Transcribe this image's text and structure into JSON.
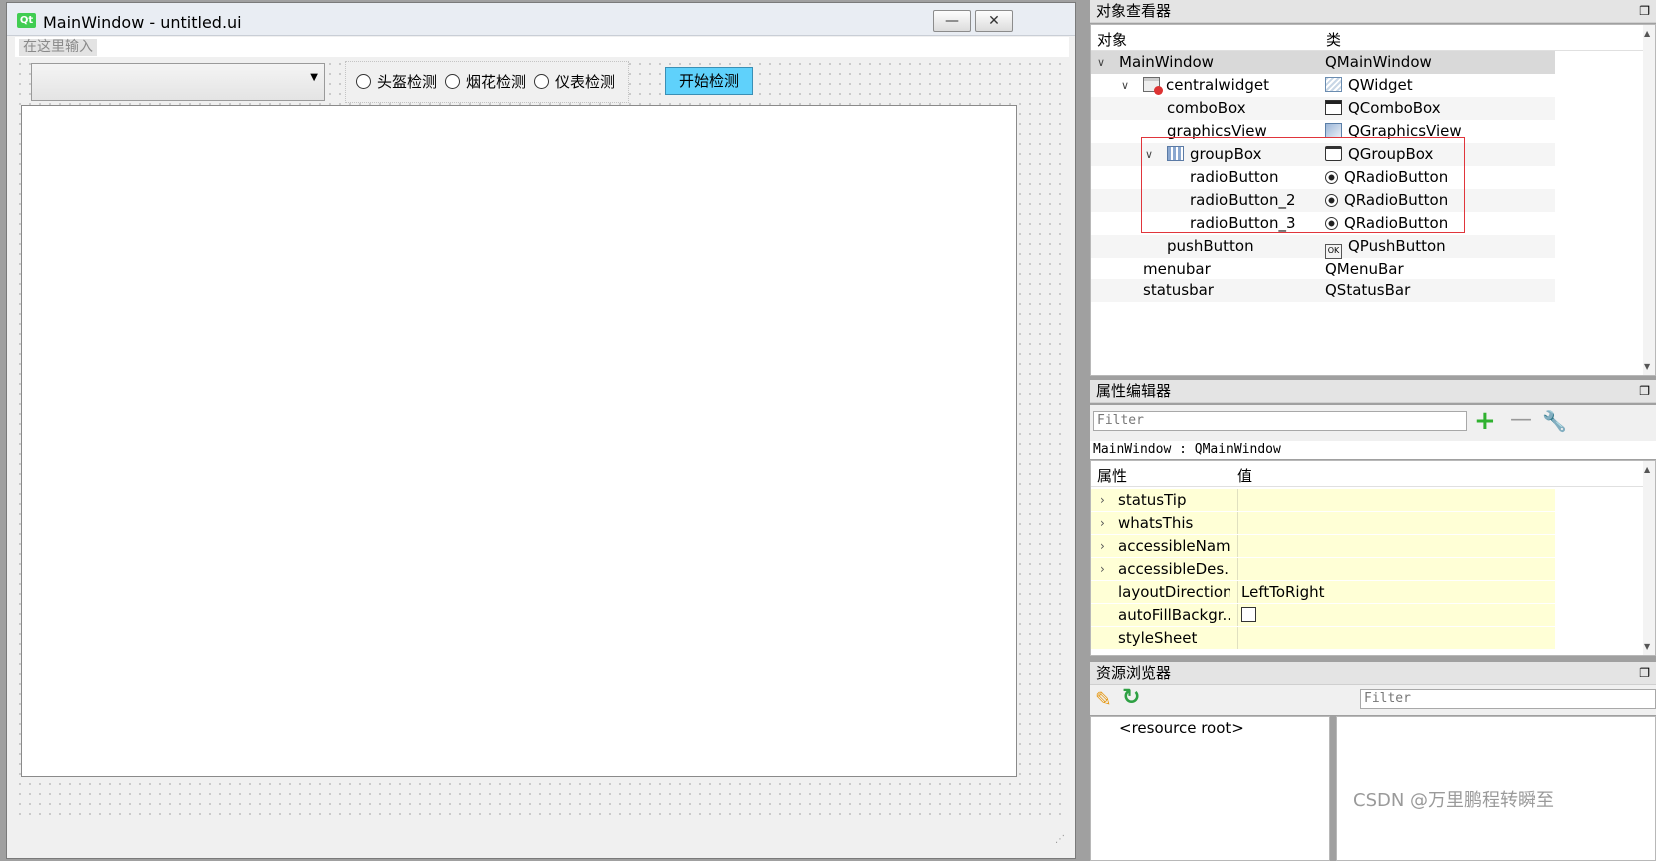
{
  "form_window": {
    "logo_text": "Qt",
    "title": "MainWindow - untitled.ui",
    "minimize_glyph": "—",
    "close_glyph": "✕",
    "menu_placeholder": "在这里输入",
    "combo_value": "",
    "radio_buttons": [
      {
        "label": "头盔检测"
      },
      {
        "label": "烟花检测"
      },
      {
        "label": "仪表检测"
      }
    ],
    "start_button": "开始检测"
  },
  "object_inspector": {
    "title": "对象查看器",
    "col_object": "对象",
    "col_class": "类",
    "rows": [
      {
        "name": "MainWindow",
        "class": "QMainWindow",
        "icon": "",
        "expanded": true
      },
      {
        "name": "centralwidget",
        "class": "QWidget",
        "icon": "widget-icon",
        "expanded": true
      },
      {
        "name": "comboBox",
        "class": "QComboBox",
        "icon": "combobox-icon"
      },
      {
        "name": "graphicsView",
        "class": "QGraphicsView",
        "icon": "graphicsview-icon"
      },
      {
        "name": "groupBox",
        "class": "QGroupBox",
        "icon": "groupbox-icon",
        "expanded": true
      },
      {
        "name": "radioButton",
        "class": "QRadioButton",
        "icon": "radiobutton-icon"
      },
      {
        "name": "radioButton_2",
        "class": "QRadioButton",
        "icon": "radiobutton-icon"
      },
      {
        "name": "radioButton_3",
        "class": "QRadioButton",
        "icon": "radiobutton-icon"
      },
      {
        "name": "pushButton",
        "class": "QPushButton",
        "icon": "pushbutton-icon"
      },
      {
        "name": "menubar",
        "class": "QMenuBar",
        "icon": ""
      },
      {
        "name": "statusbar",
        "class": "QStatusBar",
        "icon": ""
      }
    ],
    "highlight_color": "#e0353b"
  },
  "property_editor": {
    "title": "属性编辑器",
    "filter_placeholder": "Filter",
    "object_label": "MainWindow : QMainWindow",
    "col_property": "属性",
    "col_value": "值",
    "rows": [
      {
        "name": "statusTip",
        "value": "",
        "expandable": true
      },
      {
        "name": "whatsThis",
        "value": "",
        "expandable": true
      },
      {
        "name": "accessibleName",
        "value": "",
        "expandable": true
      },
      {
        "name": "accessibleDes...",
        "value": "",
        "expandable": true
      },
      {
        "name": "layoutDirection",
        "value": "LeftToRight",
        "expandable": false
      },
      {
        "name": "autoFillBackgr...",
        "value": "",
        "checkbox": true,
        "checked": false
      },
      {
        "name": "styleSheet",
        "value": "",
        "expandable": false
      }
    ]
  },
  "resource_browser": {
    "title": "资源浏览器",
    "filter_placeholder": "Filter",
    "root_label": "<resource root>"
  },
  "watermark": "CSDN @万里鹏程转瞬至",
  "colors": {
    "start_button_bg": "#5fd1fb",
    "property_row_bg": "#ffffd6",
    "selected_row_bg": "#d9d9d9"
  }
}
